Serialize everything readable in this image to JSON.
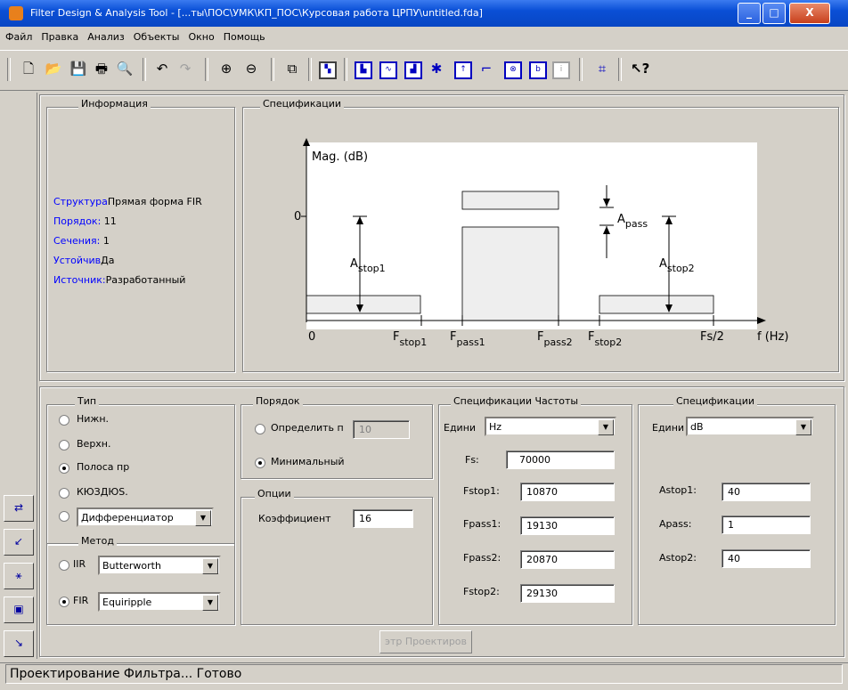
{
  "window": {
    "title": "Filter Design & Analysis Tool - [...ты\\ПОС\\УМК\\КП_ПОС\\Курсовая работа ЦРПУ\\untitled.fda]"
  },
  "menu": [
    "Файл",
    "Правка",
    "Анализ",
    "Объекты",
    "Окно",
    "Помощь"
  ],
  "info": {
    "legend": "Информация",
    "rows": [
      {
        "key": "Структура",
        "value": "Прямая форма FIR"
      },
      {
        "key": "Порядок:",
        "value": "11"
      },
      {
        "key": "Сечения:",
        "value": "1"
      },
      {
        "key": "Устойчив",
        "value": "Да"
      },
      {
        "key": "Источник:",
        "value": "Разработанный"
      }
    ]
  },
  "spec_panel": {
    "legend": "Спецификации",
    "ylabel": "Mag. (dB)",
    "zero": "0",
    "x0": "0",
    "fs2": "Fs/2",
    "fhz": "f (Hz)",
    "Astop1": "A",
    "Astop1_sub": "stop1",
    "Apass": "A",
    "Apass_sub": "pass",
    "Astop2": "A",
    "Astop2_sub": "stop2",
    "Fstop1": "F",
    "Fstop1_sub": "stop1",
    "Fpass1": "F",
    "Fpass1_sub": "pass1",
    "Fpass2": "F",
    "Fpass2_sub": "pass2",
    "Fstop2": "F",
    "Fstop2_sub": "stop2"
  },
  "type": {
    "legend": "Тип",
    "options": [
      "Нижн.",
      "Верхн.",
      "Полоса пр",
      "КЮЗДЮS.",
      ""
    ],
    "selected": 2,
    "diff_select": "Дифференциатор"
  },
  "method": {
    "legend": "Метод",
    "iir_label": "IIR",
    "iir_value": "Butterworth",
    "fir_label": "FIR",
    "fir_value": "Equiripple",
    "selected": "FIR"
  },
  "order": {
    "legend": "Порядок",
    "define_label": "Определить п",
    "define_value": "10",
    "min_label": "Минимальный",
    "selected": "min"
  },
  "options": {
    "legend": "Опции",
    "coef_label": "Коэффициент",
    "coef_value": "16"
  },
  "freq": {
    "legend": "Спецификации Частоты",
    "units_label": "Едини",
    "units_value": "Hz",
    "fields": [
      {
        "label": "Fs:",
        "value": "70000"
      },
      {
        "label": "Fstop1:",
        "value": "10870"
      },
      {
        "label": "Fpass1:",
        "value": "19130"
      },
      {
        "label": "Fpass2:",
        "value": "20870"
      },
      {
        "label": "Fstop2:",
        "value": "29130"
      }
    ]
  },
  "mag": {
    "legend": "Спецификации",
    "units_label": "Едини",
    "units_value": "dB",
    "fields": [
      {
        "label": "Astop1:",
        "value": "40"
      },
      {
        "label": "Apass:",
        "value": "1"
      },
      {
        "label": "Astop2:",
        "value": "40"
      }
    ]
  },
  "design_button": "этр Проектиров",
  "status": "Проектирование Фильтра... Готово"
}
